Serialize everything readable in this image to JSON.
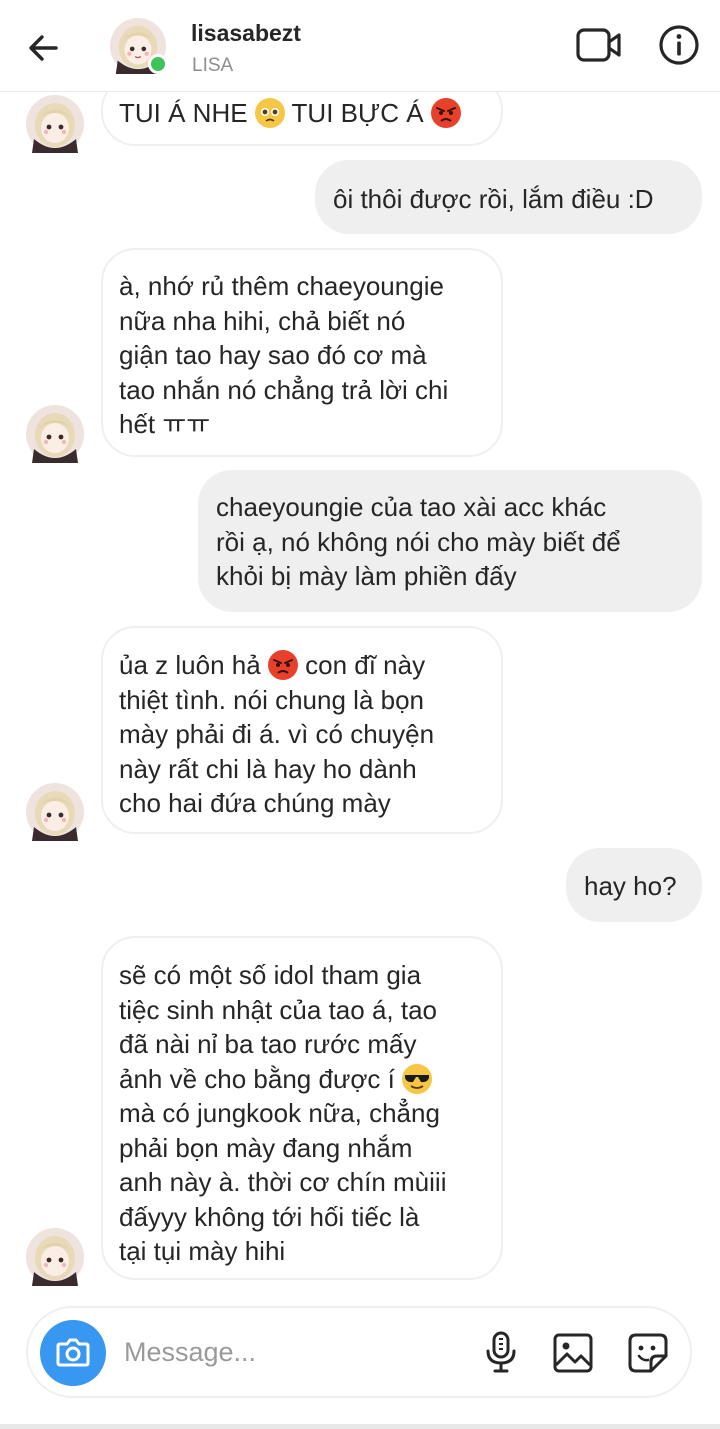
{
  "header": {
    "username": "lisasabezt",
    "subname": "LISA",
    "icons": {
      "back": "arrow-left-icon",
      "video": "video-camera-icon",
      "info": "info-icon"
    },
    "online_color": "#3cc45a"
  },
  "messages": [
    {
      "side": "incoming",
      "parts": [
        "TUI Á NHE ",
        "[pleading-face-emoji]",
        " TUI BỰC Á ",
        "[angry-face-emoji]"
      ]
    },
    {
      "side": "outgoing",
      "text": "ôi thôi được rồi, lắm điều :D"
    },
    {
      "side": "incoming",
      "text": "à, nhớ rủ thêm chaeyoungie\nnữa nha hihi, chả biết nó\ngiận tao hay sao đó cơ mà\ntao nhắn nó chẳng trả lời chi\nhết ㅠㅠ"
    },
    {
      "side": "outgoing",
      "text": "chaeyoungie của tao xài acc khác\nrồi ạ, nó không nói cho mày biết để\nkhỏi bị mày làm phiền đấy"
    },
    {
      "side": "incoming",
      "parts": [
        "ủa z luôn hả ",
        "[angry-face-emoji]",
        " con đĩ này\nthiệt tình. nói chung là bọn\nmày phải đi á. vì có chuyện\nnày rất chi là hay ho dành\ncho hai đứa chúng mày"
      ]
    },
    {
      "side": "outgoing",
      "text": "hay ho?"
    },
    {
      "side": "incoming",
      "parts": [
        "sẽ có một số idol tham gia\ntiệc sinh nhật của tao á, tao\nđã nài nỉ ba tao rước mấy\nảnh về cho bằng được í ",
        "[sunglasses-face-emoji]",
        "\nmà có jungkook nữa, chẳng\nphải bọn mày đang nhắm\nanh này à. thời cơ chín mùiii\nđấyyy không tới hối tiếc là\ntại tụi mày hihi"
      ]
    }
  ],
  "composer": {
    "placeholder": "Message...",
    "icons": {
      "camera": "camera-icon",
      "mic": "microphone-icon",
      "gallery": "image-gallery-icon",
      "sticker": "sticker-icon"
    },
    "camera_color": "#3897f0"
  }
}
